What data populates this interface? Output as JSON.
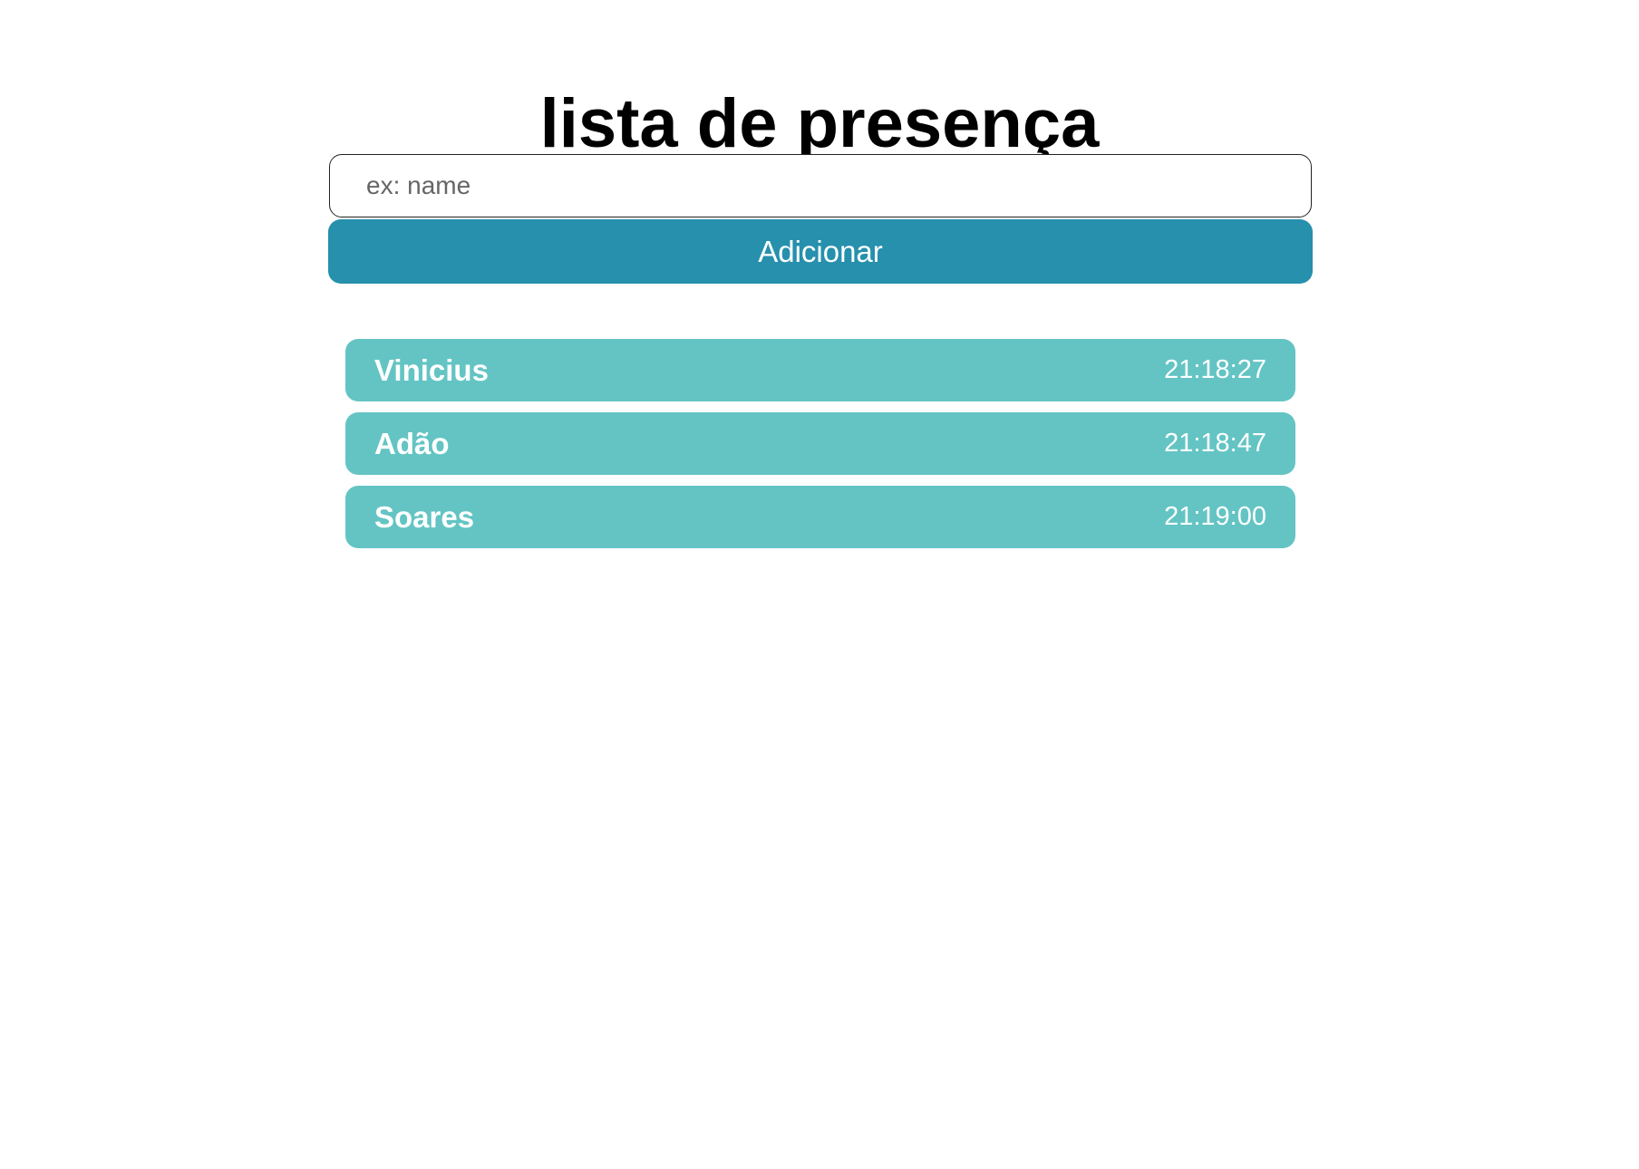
{
  "header": {
    "title": "lista de presença"
  },
  "form": {
    "input_placeholder": "ex: name",
    "input_value": "",
    "add_button_label": "Adicionar"
  },
  "attendance": [
    {
      "name": "Vinicius",
      "time": "21:18:27"
    },
    {
      "name": "Adão",
      "time": "21:18:47"
    },
    {
      "name": "Soares",
      "time": "21:19:00"
    }
  ],
  "colors": {
    "button": "#2690ad",
    "list_item": "#64c4c4",
    "list_text": "#ffffff"
  }
}
